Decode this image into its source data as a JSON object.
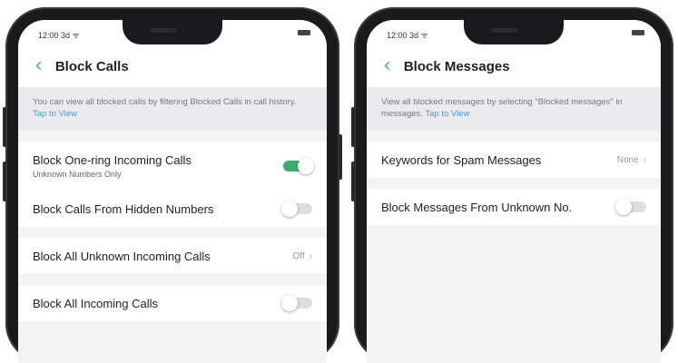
{
  "left_phone": {
    "status": {
      "time": "12:00 3d ᯤ"
    },
    "nav": {
      "title": "Block Calls"
    },
    "info": {
      "text": "You can view all blocked calls by filtering Blocked Calls in call history.",
      "link": "Tap to View"
    },
    "settings": [
      {
        "label": "Block One-ring Incoming Calls",
        "sub": "Unknown Numbers Only",
        "toggle": "on"
      },
      {
        "label": "Block Calls From Hidden Numbers",
        "toggle": "off"
      },
      {
        "label": "Block All Unknown Incoming Calls",
        "value": "Off"
      },
      {
        "label": "Block All Incoming Calls",
        "toggle": "off"
      }
    ]
  },
  "right_phone": {
    "status": {
      "time": "12:00 3d ᯤ"
    },
    "nav": {
      "title": "Block Messages"
    },
    "info": {
      "text": "View all blocked messages by selecting \"Blocked messages\" in messages.",
      "link": "Tap to View"
    },
    "settings": [
      {
        "label": "Keywords for Spam Messages",
        "value": "None"
      },
      {
        "label": "Block  Messages From Unknown No.",
        "toggle": "off"
      }
    ]
  },
  "icons": {
    "back": "chevron-left-icon",
    "chevron": "chevron-right-icon"
  },
  "colors": {
    "accent_green": "#34b06c",
    "link_blue": "#3a9ee4",
    "back_green": "#3dbb7c"
  },
  "glyphs": {
    "back": "‹",
    "chevron": "›"
  }
}
